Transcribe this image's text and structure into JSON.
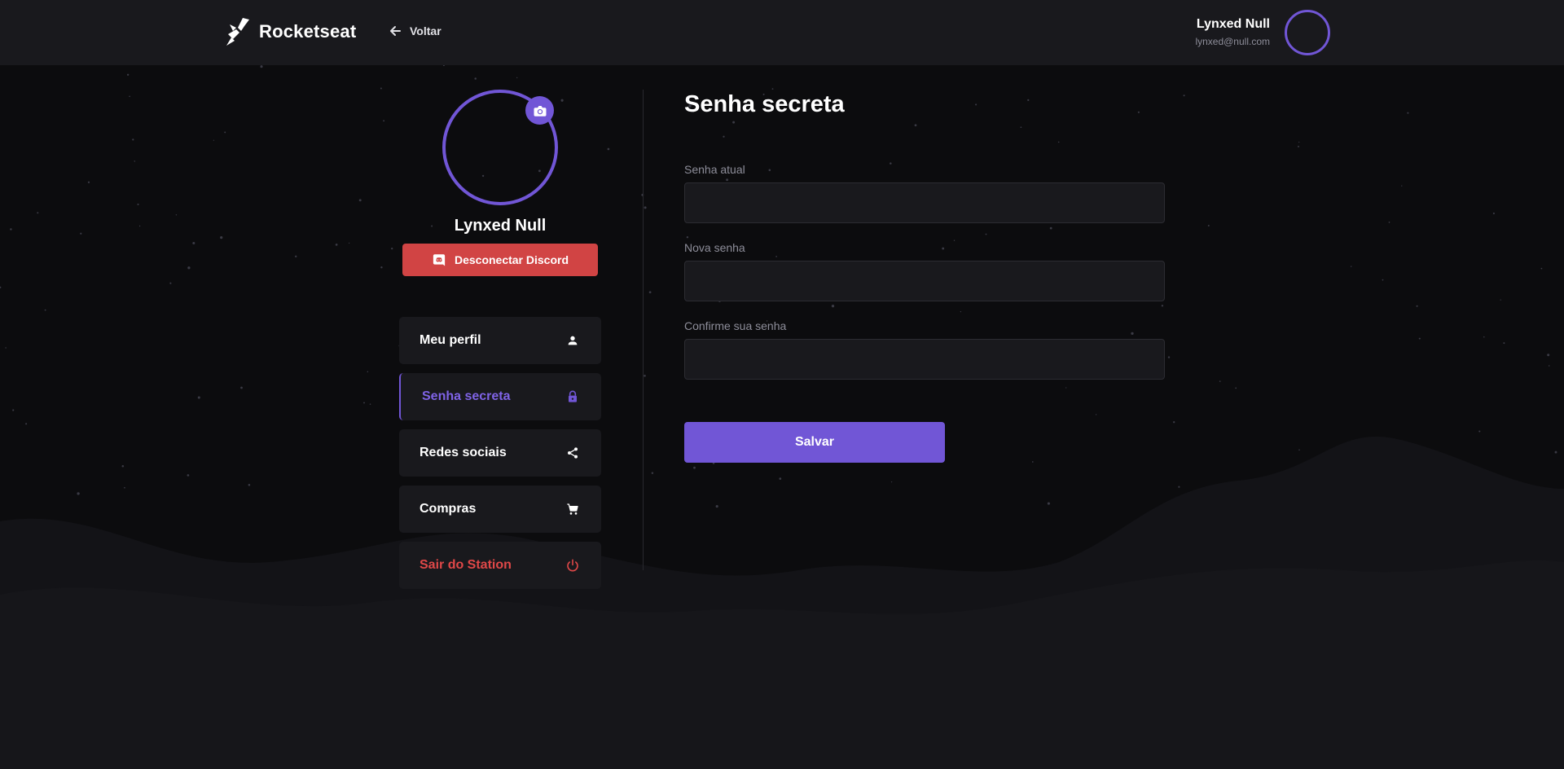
{
  "colors": {
    "accent": "#7156d6",
    "danger": "#d14444",
    "background": "#0c0c0e",
    "surface": "#19191d"
  },
  "header": {
    "brand": "Rocketseat",
    "back_label": "Voltar",
    "user_name": "Lynxed Null",
    "user_email": "lynxed@null.com"
  },
  "sidebar": {
    "profile_name": "Lynxed Null",
    "discord_button": "Desconectar Discord",
    "items": [
      {
        "label": "Meu perfil",
        "icon": "user-icon"
      },
      {
        "label": "Senha secreta",
        "icon": "lock-icon",
        "active": true
      },
      {
        "label": "Redes sociais",
        "icon": "share-icon"
      },
      {
        "label": "Compras",
        "icon": "cart-icon"
      },
      {
        "label": "Sair do Station",
        "icon": "power-icon"
      }
    ]
  },
  "main": {
    "title": "Senha secreta",
    "fields": [
      {
        "label": "Senha atual",
        "value": ""
      },
      {
        "label": "Nova senha",
        "value": ""
      },
      {
        "label": "Confirme sua senha",
        "value": ""
      }
    ],
    "save_label": "Salvar"
  }
}
